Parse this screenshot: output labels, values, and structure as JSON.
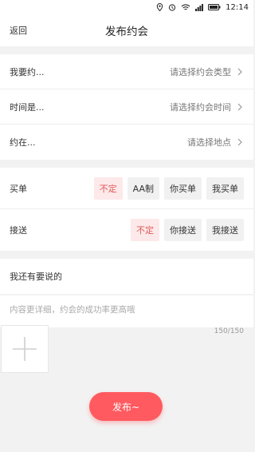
{
  "status": {
    "time": "12:14"
  },
  "header": {
    "back": "返回",
    "title": "发布约会"
  },
  "fields": [
    {
      "label": "我要约...",
      "value": "请选择约会类型"
    },
    {
      "label": "时间是...",
      "value": "请选择约会时间"
    },
    {
      "label": "约在...",
      "value": "请选择地点"
    }
  ],
  "payment": {
    "label": "买单",
    "options": [
      "不定",
      "AA制",
      "你买单",
      "我买单"
    ],
    "selected": 0
  },
  "pickup": {
    "label": "接送",
    "options": [
      "不定",
      "你接送",
      "我接送"
    ],
    "selected": 0
  },
  "notes": {
    "title": "我还有要说的",
    "placeholder": "内容更详细，约会的成功率更高哦",
    "counter": "150/150"
  },
  "publish_label": "发布~",
  "colors": {
    "accent": "#ff5a5f",
    "active_bg": "#fde9e9",
    "active_text": "#e05a5a"
  }
}
